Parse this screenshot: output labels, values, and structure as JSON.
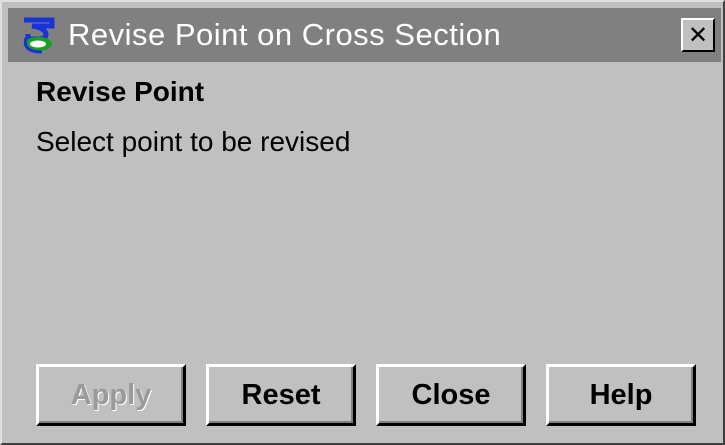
{
  "window": {
    "title": "Revise Point on Cross Section",
    "close_glyph": "✕",
    "app_icon": "app-logo-icon"
  },
  "content": {
    "heading": "Revise Point",
    "message": "Select point to be revised"
  },
  "buttons": {
    "apply": "Apply",
    "reset": "Reset",
    "close": "Close",
    "help": "Help"
  },
  "states": {
    "apply_enabled": false
  },
  "colors": {
    "titlebar": "#808080",
    "background": "#c0c0c0",
    "icon_blue": "#1a33d6",
    "icon_green": "#1a9e2a"
  }
}
